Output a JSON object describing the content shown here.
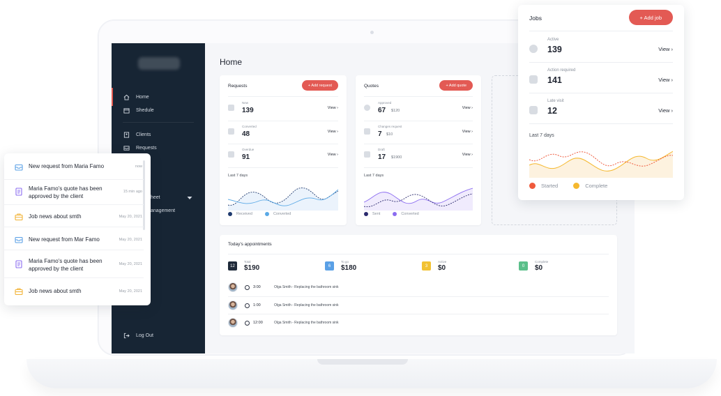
{
  "screen": {
    "page_title": "Home",
    "sidebar": {
      "items": [
        {
          "label": "Home",
          "icon": "home-icon"
        },
        {
          "label": "Shedule",
          "icon": "calendar-icon"
        },
        {
          "label": "Clients",
          "icon": "clients-icon"
        },
        {
          "label": "Requests",
          "icon": "requests-icon"
        },
        {
          "label": "heet",
          "icon": ""
        },
        {
          "label": "anagement",
          "icon": ""
        }
      ],
      "logout_label": "Log Out"
    },
    "requests": {
      "title": "Requests",
      "add_label": "+ Add request",
      "rows": [
        {
          "label": "New",
          "value": "139",
          "view": "View"
        },
        {
          "label": "Converted",
          "value": "48",
          "view": "View"
        },
        {
          "label": "Overdue",
          "value": "91",
          "view": "View"
        }
      ],
      "last_days": "Last 7 days",
      "legend": [
        {
          "name": "Received",
          "color": "#1f3a6e"
        },
        {
          "name": "Converted",
          "color": "#5aa9e6"
        }
      ]
    },
    "quotes": {
      "title": "Quotes",
      "add_label": "+ Add quote",
      "rows": [
        {
          "label": "Approved",
          "value": "67",
          "sub": "$120",
          "view": "View"
        },
        {
          "label": "Changes request",
          "value": "7",
          "sub": "$10",
          "view": "View"
        },
        {
          "label": "Draft",
          "value": "17",
          "sub": "$1900",
          "view": "View"
        }
      ],
      "last_days": "Last 7 days",
      "legend": [
        {
          "name": "Sent",
          "color": "#2b2a6e"
        },
        {
          "name": "Converted",
          "color": "#8b6cf0"
        }
      ]
    },
    "appointments": {
      "title": "Today's appointments",
      "stats": [
        {
          "badge": "12",
          "label": "Total",
          "value": "$190",
          "color": "#1f2a3a"
        },
        {
          "badge": "6",
          "label": "To go",
          "value": "$180",
          "color": "#5aa0e6"
        },
        {
          "badge": "3",
          "label": "Active",
          "value": "$0",
          "color": "#f2c233"
        },
        {
          "badge": "0",
          "label": "Complete",
          "value": "$0",
          "color": "#5bbf8a"
        }
      ],
      "rows": [
        {
          "time": "3:00",
          "desc": "Olga Smith - Replacing the bathroom sink"
        },
        {
          "time": "1:00",
          "desc": "Olga Smith - Replacing the bathroom sink"
        },
        {
          "time": "12:00",
          "desc": "Olga Smith - Replacing the bathroom sink"
        }
      ]
    }
  },
  "notifications": [
    {
      "text": "New request from Maria Famo",
      "time": "now",
      "icon": "inbox-icon",
      "color": "#5aa0e6"
    },
    {
      "text": "Maria Famo's quote has been approved by the client",
      "time": "15 min ago",
      "icon": "document-icon",
      "color": "#8b6cf0"
    },
    {
      "text": "Job news about smth",
      "time": "May 20, 2021",
      "icon": "briefcase-icon",
      "color": "#f2b233"
    },
    {
      "text": "New request from Mar Famo",
      "time": "May 20, 2021",
      "icon": "inbox-icon",
      "color": "#5aa0e6"
    },
    {
      "text": "Maria Famo's quote has been approved by the client",
      "time": "May 20, 2021",
      "icon": "document-icon",
      "color": "#8b6cf0"
    },
    {
      "text": "Job news about smth",
      "time": "May 20, 2021",
      "icon": "briefcase-icon",
      "color": "#f2b233"
    }
  ],
  "jobs": {
    "title": "Jobs",
    "add_label": "+ Add job",
    "rows": [
      {
        "label": "Active",
        "value": "139",
        "view": "View"
      },
      {
        "label": "Action required",
        "value": "141",
        "view": "View"
      },
      {
        "label": "Late visit",
        "value": "12",
        "view": "View"
      }
    ],
    "last_days": "Last 7 days",
    "legend": [
      {
        "name": "Started",
        "color": "#ef5a3c"
      },
      {
        "name": "Complete",
        "color": "#f5b82e"
      }
    ]
  },
  "colors": {
    "accent": "#e35a54",
    "sidebar": "#172534"
  }
}
